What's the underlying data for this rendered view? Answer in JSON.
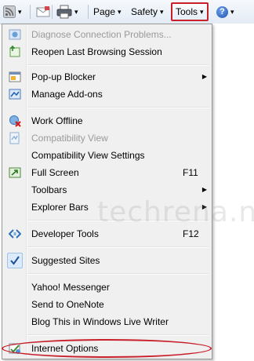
{
  "toolbar": {
    "page_label": "Page",
    "safety_label": "Safety",
    "tools_label": "Tools",
    "help_glyph": "?",
    "arrow": "▾",
    "icons": [
      "rss-feed-icon",
      "read-mail-icon",
      "print-icon",
      "help-icon"
    ]
  },
  "menu": {
    "submenu_arrow": "▶",
    "items": [
      {
        "label": "Diagnose Connection Problems...",
        "icon": "diagnose-icon",
        "disabled": true
      },
      {
        "label": "Reopen Last Browsing Session",
        "icon": "reopen-session-icon"
      },
      {
        "label": "Pop-up Blocker",
        "icon": "popup-blocker-icon",
        "submenu": true
      },
      {
        "label": "Manage Add-ons",
        "icon": "manage-addons-icon"
      },
      {
        "label": "Work Offline",
        "icon": "work-offline-icon"
      },
      {
        "label": "Compatibility View",
        "icon": "compatibility-view-icon",
        "disabled": true
      },
      {
        "label": "Compatibility View Settings"
      },
      {
        "label": "Full Screen",
        "icon": "full-screen-icon",
        "shortcut": "F11"
      },
      {
        "label": "Toolbars",
        "submenu": true
      },
      {
        "label": "Explorer Bars",
        "submenu": true
      },
      {
        "label": "Developer Tools",
        "icon": "developer-tools-icon",
        "shortcut": "F12"
      },
      {
        "label": "Suggested Sites",
        "icon": "checkmark-icon"
      },
      {
        "label": "Yahoo! Messenger"
      },
      {
        "label": "Send to OneNote"
      },
      {
        "label": "Blog This in Windows Live Writer"
      },
      {
        "label": "Internet Options",
        "icon": "internet-options-icon"
      }
    ]
  },
  "watermark": "techrena.net",
  "colors": {
    "highlight_red": "#c8202a",
    "menu_bg": "#f0f0f0"
  }
}
